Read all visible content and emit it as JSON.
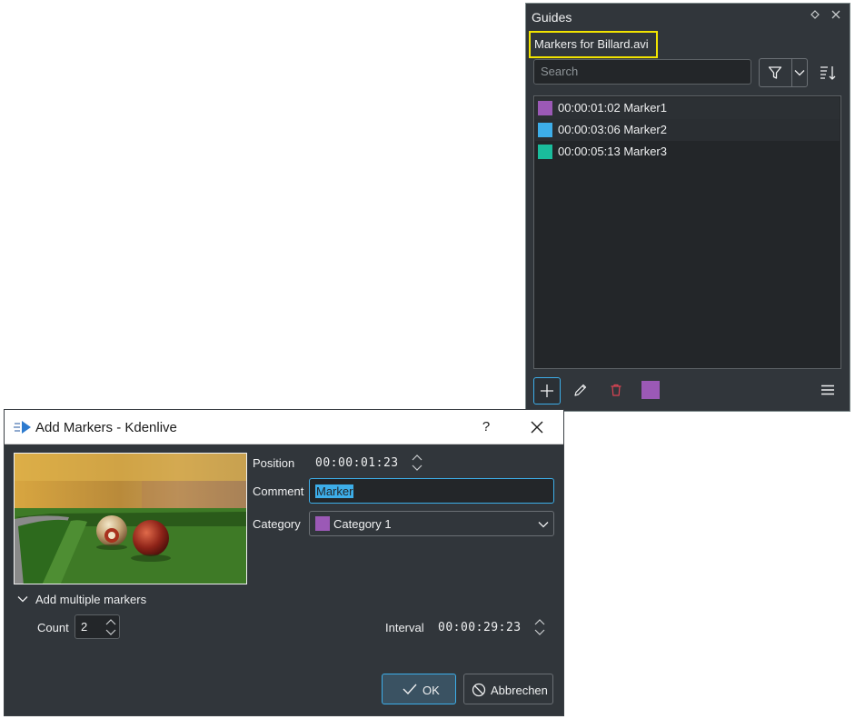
{
  "guides": {
    "title": "Guides",
    "clip_label": "Markers for Billard.avi",
    "search_placeholder": "Search",
    "markers": [
      {
        "time": "00:00:01:02",
        "name": "Marker1",
        "color": "#9b59b6"
      },
      {
        "time": "00:00:03:06",
        "name": "Marker2",
        "color": "#3daee9"
      },
      {
        "time": "00:00:05:13",
        "name": "Marker3",
        "color": "#1abc9c"
      }
    ],
    "toolbar": {
      "add_icon": "plus-icon",
      "edit_icon": "pencil-icon",
      "delete_icon": "trash-icon",
      "category_color": "#9b59b6",
      "menu_icon": "hamburger-menu-icon"
    }
  },
  "dialog": {
    "title": "Add Markers - Kdenlive",
    "help_label": "?",
    "position_label": "Position",
    "position_value": "00:00:01:23",
    "comment_label": "Comment",
    "comment_value": "Marker",
    "category_label": "Category",
    "category_value": "Category 1",
    "category_color": "#9b59b6",
    "multiple_label": "Add multiple markers",
    "count_label": "Count",
    "count_value": "2",
    "interval_label": "Interval",
    "interval_value": "00:00:29:23",
    "ok_label": "OK",
    "cancel_label": "Abbrechen"
  },
  "colors": {
    "accent": "#3daee9",
    "panel_bg": "#31363b",
    "list_bg": "#232629",
    "highlight": "#f2e400",
    "delete": "#da4453"
  }
}
